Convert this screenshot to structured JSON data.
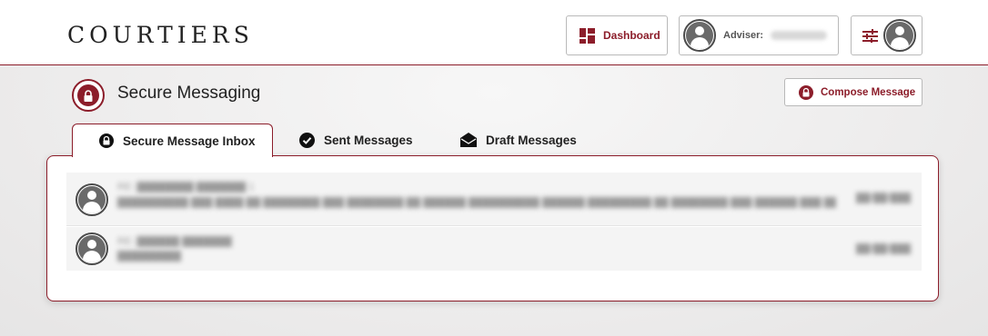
{
  "header": {
    "logo": "COURTIERS",
    "dashboard_label": "Dashboard",
    "adviser_label": "Adviser:",
    "icons": {
      "dashboard": "dashboard-grid-icon",
      "avatar": "user-avatar-icon",
      "settings": "sliders-icon"
    }
  },
  "page": {
    "title": "Secure Messaging",
    "compose_label": "Compose Message",
    "icons": {
      "title": "lock-icon",
      "compose": "lock-icon"
    }
  },
  "tabs": [
    {
      "label": "Secure Message Inbox",
      "icon": "lock-icon",
      "active": true
    },
    {
      "label": "Sent Messages",
      "icon": "check-circle-icon",
      "active": false
    },
    {
      "label": "Draft Messages",
      "icon": "open-envelope-icon",
      "active": false
    }
  ],
  "messages": [
    {
      "subject": "RE: ████████ ███████ 1",
      "preview": "██████████ ███ ████ ██ ████████ ███ ████████ ██ ██████ ██████████ ██████ █████████ ██ ████████ ███ ██████ ███ ██████ ████ ██████████ ███ ███████ ████████ ██ ██████ ██",
      "date": "██/██/████"
    },
    {
      "subject": "RE: ██████ ███████",
      "preview": "██████████",
      "date": "██/██/████"
    }
  ],
  "colors": {
    "brand": "#8c1d2a",
    "text": "#222222",
    "muted": "#9a9a9a"
  }
}
